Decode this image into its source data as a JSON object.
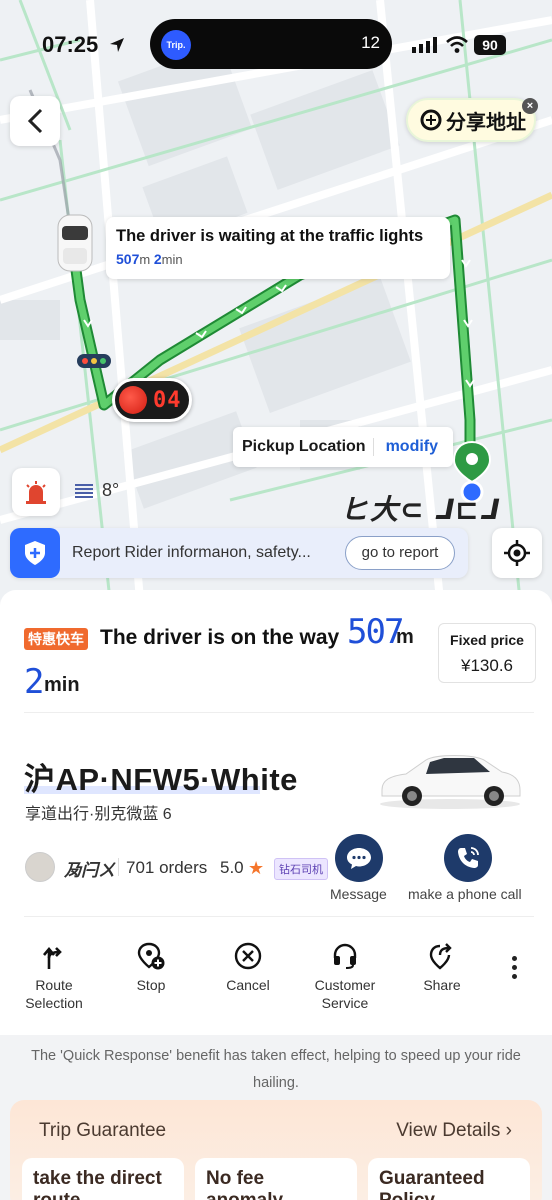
{
  "status_bar": {
    "time": "07:25",
    "island_badge": "Trip.",
    "island_number": "12",
    "battery": "90"
  },
  "map": {
    "share_label": "分享地址",
    "close_glyph": "×",
    "waiting_title": "The driver is waiting at the traffic lights",
    "waiting_distance_value": "507",
    "waiting_distance_unit": "m",
    "waiting_time_value": "2",
    "waiting_time_unit": "min",
    "light_countdown": "04",
    "pickup_label": "Pickup Location",
    "pickup_modify": "modify",
    "handwritten_label": "ヒ大⊂ ⅃⊏⅃",
    "temperature": "8°",
    "report_text": "Report Rider informaнon, safety...",
    "report_button": "go to report"
  },
  "trip": {
    "tag": "特惠快车",
    "status": "The driver is on the way",
    "distance_value": "507",
    "distance_unit": "m",
    "eta_value": "2",
    "eta_unit": "min",
    "price_label": "Fixed price",
    "price_value": "¥130.6"
  },
  "vehicle": {
    "plate": "沪AP·NFW5·White",
    "model": "享道出行·别克微蓝 6"
  },
  "driver": {
    "name": "夃闩ㄨ",
    "orders": "701 orders",
    "rating": "5.0",
    "star": "★",
    "badge": "钻石司机",
    "message_label": "Message",
    "call_label": "make a phone call"
  },
  "actions": [
    {
      "label": "Route Selection",
      "icon": "route-icon"
    },
    {
      "label": "Stop",
      "icon": "add-stop-icon"
    },
    {
      "label": "Cancel",
      "icon": "cancel-icon"
    },
    {
      "label": "Customer Service",
      "icon": "headset-icon"
    },
    {
      "label": "Share",
      "icon": "share-icon"
    }
  ],
  "footer": {
    "benefit": "The 'Quick Response' benefit has taken effect, helping to speed up your ride hailing.",
    "guarantee_title": "Trip Guarantee",
    "view_details": "View Details",
    "chevron": "›",
    "cards": [
      "take the direct route",
      "No fee anomaly",
      "Guaranteed Policy"
    ]
  },
  "colors": {
    "accent_blue": "#1f4fd8",
    "route_green": "#3aa44b",
    "tag_orange": "#f06a2e",
    "navy": "#1e3a6a"
  }
}
